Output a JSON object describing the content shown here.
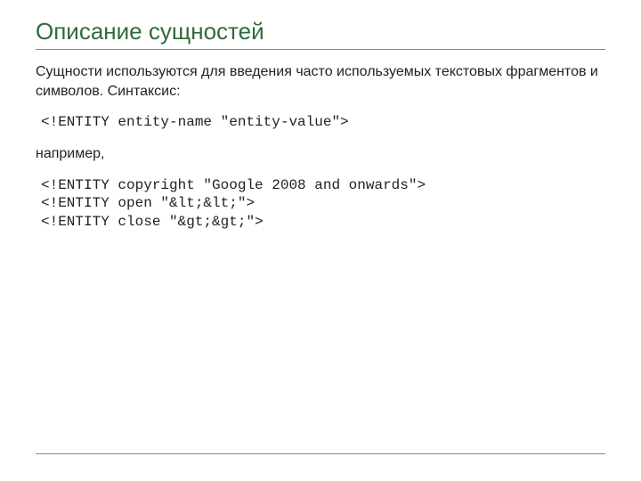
{
  "title": "Описание сущностей",
  "intro": "Сущности используются для введения часто используемых текстовых фрагментов и символов. Синтаксис:",
  "syntax": "<!ENTITY entity-name \"entity-value\">",
  "example_lead": "например,",
  "examples": "<!ENTITY copyright \"Google 2008 and onwards\">\n<!ENTITY open \"&lt;&lt;\">\n<!ENTITY close \"&gt;&gt;\">"
}
